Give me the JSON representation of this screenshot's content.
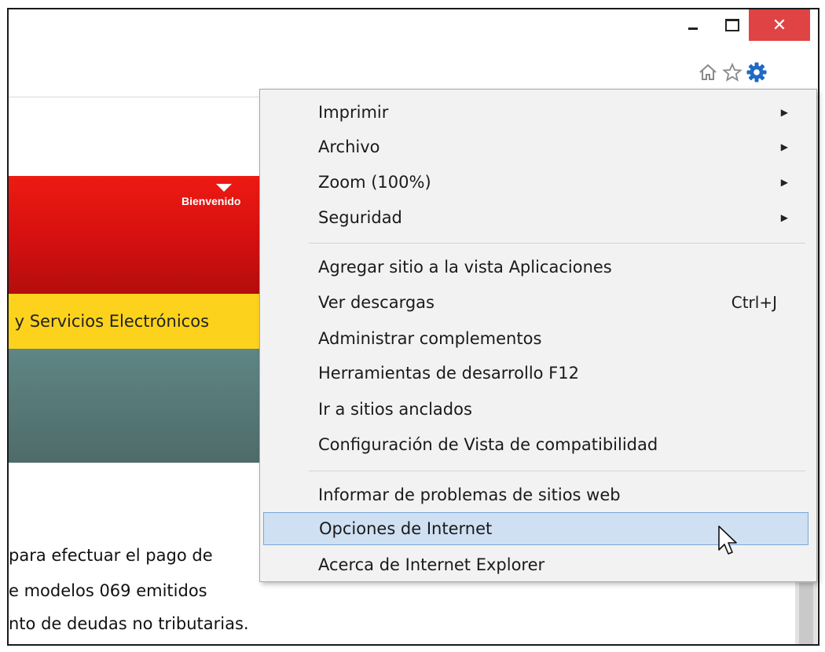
{
  "window": {
    "minimize_icon": "minimize-icon",
    "maximize_icon": "maximize-icon",
    "close_glyph": "✕"
  },
  "toolbar": {
    "icons": [
      "home-icon",
      "favorites-star-icon",
      "tools-gear-icon"
    ],
    "accent_color": "#1e6ac5"
  },
  "page": {
    "welcome": "Bienvenido",
    "nav_text": "s y Servicios Electrónicos",
    "body_lines": [
      " para efectuar el pago de",
      "e modelos 069 emitidos",
      "nto de deudas no tributarias."
    ],
    "colors": {
      "red": "#e0140f",
      "yellow": "#fcd21d",
      "teal": "#557977"
    }
  },
  "menu": {
    "groups": [
      [
        {
          "label": "Imprimir",
          "submenu": true
        },
        {
          "label": "Archivo",
          "submenu": true
        },
        {
          "label": "Zoom (100%)",
          "submenu": true
        },
        {
          "label": "Seguridad",
          "submenu": true
        }
      ],
      [
        {
          "label": "Agregar sitio a la vista Aplicaciones"
        },
        {
          "label": "Ver descargas",
          "shortcut": "Ctrl+J"
        },
        {
          "label": "Administrar complementos"
        },
        {
          "label": "Herramientas de desarrollo F12"
        },
        {
          "label": "Ir a sitios anclados"
        },
        {
          "label": "Configuración de Vista de compatibilidad"
        }
      ],
      [
        {
          "label": "Informar de problemas de sitios web"
        },
        {
          "label": "Opciones de Internet",
          "highlighted": true
        },
        {
          "label": "Acerca de Internet Explorer"
        }
      ]
    ]
  }
}
